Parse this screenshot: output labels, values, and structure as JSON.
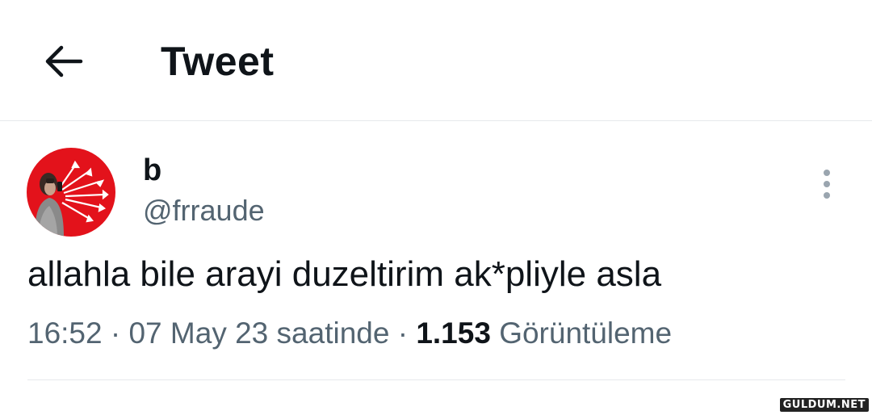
{
  "header": {
    "title": "Tweet",
    "back_icon": "arrow-left-icon"
  },
  "tweet": {
    "display_name": "b",
    "handle": "@frraude",
    "text": "allahla bile arayi duzeltirim ak*pliyle asla",
    "time": "16:52",
    "date": "07 May 23 saatinde",
    "separator": "·",
    "views_count": "1.153",
    "views_label": "Görüntüleme",
    "avatar_color": "#e3121b",
    "more_icon": "more-vertical-icon"
  },
  "colors": {
    "text_primary": "#0f1419",
    "text_secondary": "#536471",
    "divider": "#e6e9ec"
  },
  "watermark": "GULDUM.NET"
}
